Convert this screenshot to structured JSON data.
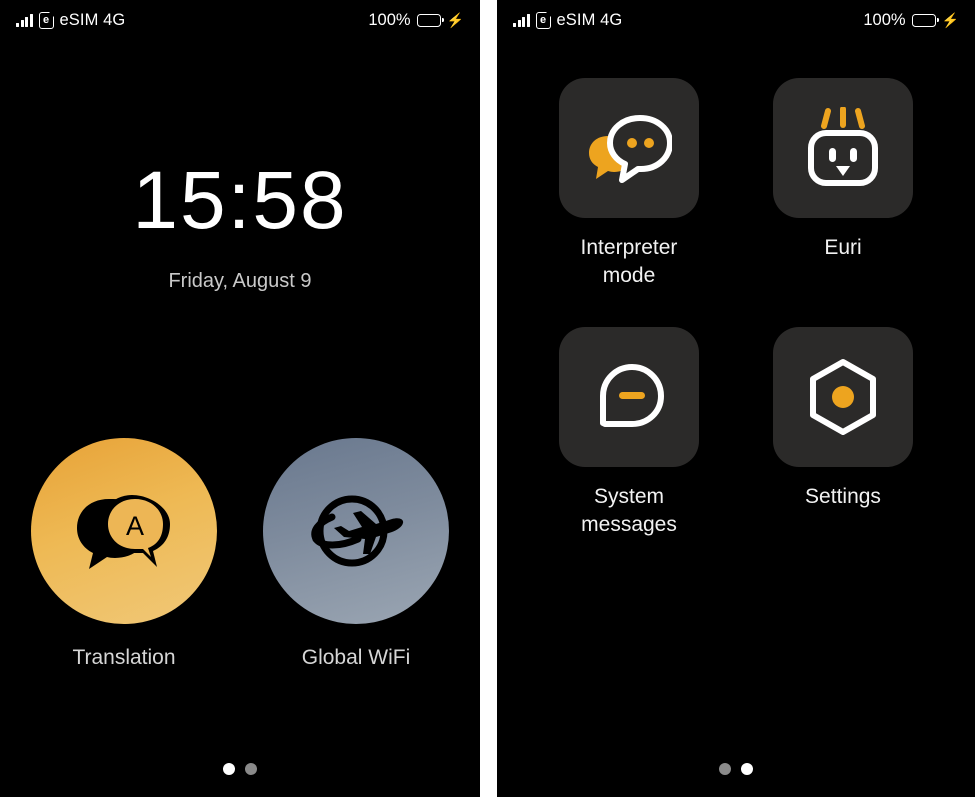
{
  "status_bar": {
    "signal_icon": "signal-bars-icon",
    "sim_icon": "esim-card-icon",
    "sim_letter": "e",
    "carrier": "eSIM 4G",
    "battery_percent": "100%",
    "battery_icon": "battery-full-icon",
    "battery_color": "#2fd327",
    "charging_icon": "lightning-bolt-icon",
    "charging_glyph": "⚡"
  },
  "left_screen": {
    "clock": {
      "time": "15:58",
      "date": "Friday, August 9"
    },
    "apps": [
      {
        "label": "Translation",
        "icon": "translation-speech-bubble-icon",
        "icon_letter": "A",
        "gradient_from": "#e7a237",
        "gradient_to": "#f0c878"
      },
      {
        "label": "Global WiFi",
        "icon": "globe-airplane-icon",
        "gradient_from": "#69788e",
        "gradient_to": "#9ba6b3"
      }
    ],
    "page_dots": {
      "count": 2,
      "active_index": 0
    }
  },
  "right_screen": {
    "tiles": [
      {
        "label": "Interpreter mode",
        "label_line1": "Interpreter",
        "label_line2": "mode",
        "icon": "two-speech-bubbles-icon",
        "accent": "#eda41f"
      },
      {
        "label": "Euri",
        "label_line1": "Euri",
        "label_line2": "",
        "icon": "robot-face-icon",
        "accent": "#eda41f"
      },
      {
        "label": "System messages",
        "label_line1": "System",
        "label_line2": "messages",
        "icon": "speech-bubble-dash-icon",
        "accent": "#eda41f"
      },
      {
        "label": "Settings",
        "label_line1": "Settings",
        "label_line2": "",
        "icon": "hexagon-dot-icon",
        "accent": "#eda41f"
      }
    ],
    "page_dots": {
      "count": 2,
      "active_index": 1
    }
  },
  "theme": {
    "background": "#000000",
    "tile_background": "#2b2a29",
    "accent_orange": "#eda41f",
    "text_primary": "#ffffff",
    "text_secondary": "#c9c9c9"
  }
}
